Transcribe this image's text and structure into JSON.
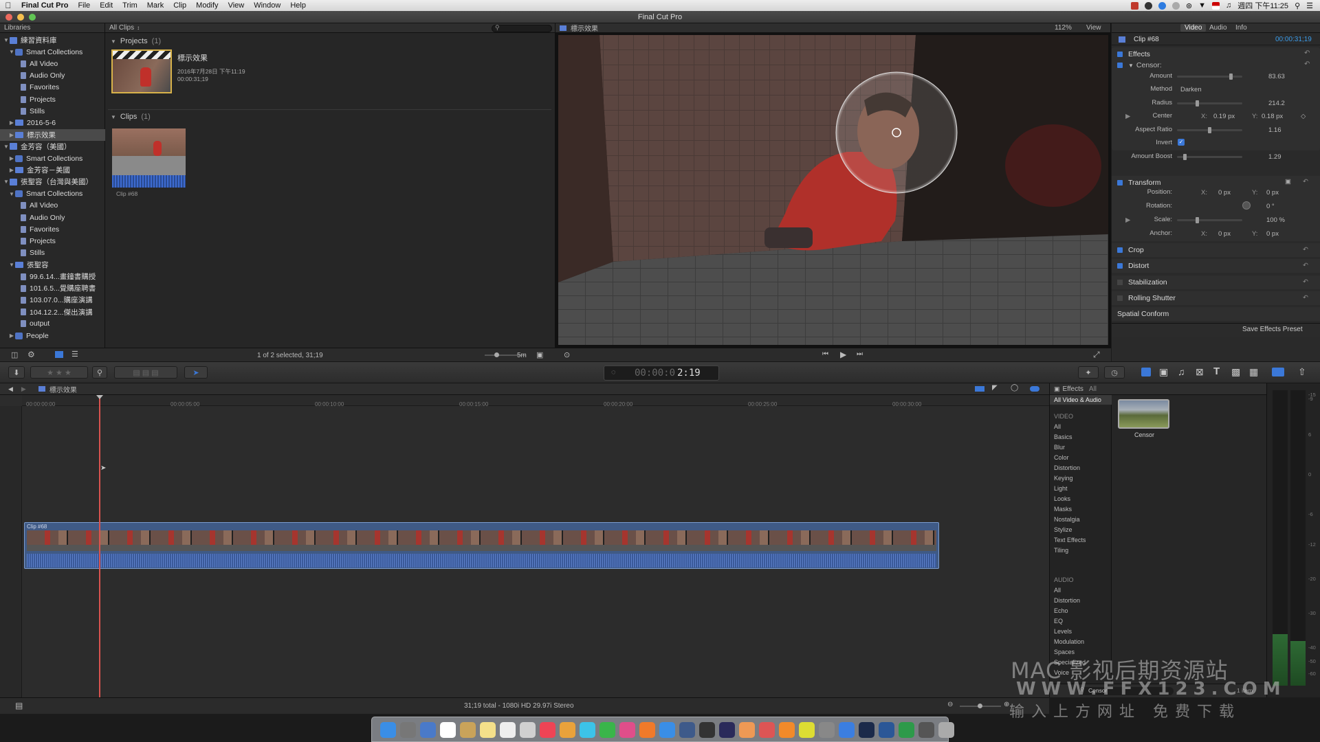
{
  "menubar": {
    "app": "Final Cut Pro",
    "items": [
      "File",
      "Edit",
      "Trim",
      "Mark",
      "Clip",
      "Modify",
      "View",
      "Window",
      "Help"
    ],
    "clock": "週四 下午11:25"
  },
  "window": {
    "title": "Final Cut Pro"
  },
  "libraries": {
    "header": "Libraries",
    "rows": [
      {
        "label": "練習資料庫",
        "level": 0,
        "icon": "library",
        "expanded": true
      },
      {
        "label": "Smart Collections",
        "level": 1,
        "icon": "folder",
        "expanded": true
      },
      {
        "label": "All Video",
        "level": 2,
        "icon": "smart-collection"
      },
      {
        "label": "Audio Only",
        "level": 2,
        "icon": "smart-collection"
      },
      {
        "label": "Favorites",
        "level": 2,
        "icon": "smart-collection"
      },
      {
        "label": "Projects",
        "level": 2,
        "icon": "smart-collection"
      },
      {
        "label": "Stills",
        "level": 2,
        "icon": "smart-collection"
      },
      {
        "label": "2016-5-6",
        "level": 1,
        "icon": "event",
        "collapsed": true
      },
      {
        "label": "標示效果",
        "level": 1,
        "icon": "event",
        "collapsed": true,
        "selected": true
      },
      {
        "label": "金芳容（美國）",
        "level": 0,
        "icon": "library",
        "expanded": true
      },
      {
        "label": "Smart Collections",
        "level": 1,
        "icon": "folder",
        "collapsed": true
      },
      {
        "label": "金芳容－美國",
        "level": 1,
        "icon": "event",
        "collapsed": true
      },
      {
        "label": "張聖容（台灣與美國）",
        "level": 0,
        "icon": "library",
        "expanded": true
      },
      {
        "label": "Smart Collections",
        "level": 1,
        "icon": "folder",
        "expanded": true
      },
      {
        "label": "All Video",
        "level": 2,
        "icon": "smart-collection"
      },
      {
        "label": "Audio Only",
        "level": 2,
        "icon": "smart-collection"
      },
      {
        "label": "Favorites",
        "level": 2,
        "icon": "smart-collection"
      },
      {
        "label": "Projects",
        "level": 2,
        "icon": "smart-collection"
      },
      {
        "label": "Stills",
        "level": 2,
        "icon": "smart-collection"
      },
      {
        "label": "張聖容",
        "level": 1,
        "icon": "event",
        "expanded": true
      },
      {
        "label": "99.6.14...畫鐘書購授",
        "level": 2,
        "icon": "project"
      },
      {
        "label": "101.6.5...覺購座聘書",
        "level": 2,
        "icon": "project"
      },
      {
        "label": "103.07.0...購座演講",
        "level": 2,
        "icon": "project"
      },
      {
        "label": "104.12.2...傑出演講",
        "level": 2,
        "icon": "project"
      },
      {
        "label": "output",
        "level": 2,
        "icon": "project"
      },
      {
        "label": "People",
        "level": 1,
        "icon": "folder",
        "collapsed": true
      }
    ]
  },
  "browser": {
    "filter": "All Clips",
    "projects_label": "Projects",
    "projects_count": "(1)",
    "project_name": "標示效果",
    "project_date": "2016年7月28日 下午11:19",
    "project_duration": "00:00:31;19",
    "clips_label": "Clips",
    "clips_count": "(1)",
    "clip_name": "Clip #68",
    "status": "1 of 2 selected, 31;19",
    "zoom": "5m"
  },
  "viewer": {
    "title": "標示效果",
    "zoom": "112%",
    "view": "View"
  },
  "inspector": {
    "tabs": [
      "Video",
      "Audio",
      "Info"
    ],
    "clip": "Clip #68",
    "timecode": "00:00:31;19",
    "effects": "Effects",
    "censor": "Censor:",
    "amount_label": "Amount",
    "amount": "83.63",
    "amount_level": 0.84,
    "method_label": "Method",
    "method": "Darken",
    "radius_label": "Radius",
    "radius": "214.2",
    "radius_level": 0.3,
    "center_label": "Center",
    "center_x": "0.19 px",
    "center_y": "0.18 px",
    "aspect_label": "Aspect Ratio",
    "aspect": "1.16",
    "aspect_level": 0.5,
    "invert_label": "Invert",
    "boost_label": "Amount Boost",
    "boost": "1.29",
    "boost_level": 0.1,
    "transform": "Transform",
    "position_label": "Position:",
    "pos_x": "0 px",
    "pos_y": "0 px",
    "rotation_label": "Rotation:",
    "rotation": "0 °",
    "scale_label": "Scale:",
    "scale": "100 %",
    "scale_level": 0.3,
    "anchor_label": "Anchor:",
    "anchor_x": "0 px",
    "anchor_y": "0 px",
    "crop": "Crop",
    "distort": "Distort",
    "stabilization": "Stabilization",
    "rolling": "Rolling Shutter",
    "spatial": "Spatial Conform",
    "save_preset": "Save Effects Preset"
  },
  "toolbar": {
    "timecode": "2:19"
  },
  "timeline": {
    "project": "標示效果",
    "ticks": [
      "00:00:00:00",
      "00:00:05:00",
      "00:00:10:00",
      "00:00:15:00",
      "00:00:20:00",
      "00:00:25:00",
      "00:00:30:00"
    ],
    "clip_label": "Clip #68",
    "status": "31;19 total - 1080i HD 29.97i Stereo"
  },
  "effects_browser": {
    "title": "Effects",
    "filter": "All",
    "all_label": "All Video & Audio",
    "video_header": "VIDEO",
    "video": [
      "All",
      "Basics",
      "Blur",
      "Color",
      "Distortion",
      "Keying",
      "Light",
      "Looks",
      "Masks",
      "Nostalgia",
      "Stylize",
      "Text Effects",
      "Tiling"
    ],
    "audio_header": "AUDIO",
    "audio": [
      "All",
      "Distortion",
      "Echo",
      "EQ",
      "Levels",
      "Modulation",
      "Spaces",
      "Specialized",
      "Voice"
    ],
    "effect_name": "Censor",
    "search_value": "Censor",
    "count": "1 item"
  },
  "meters": {
    "scale": [
      "-15",
      "-9",
      "6",
      "0",
      "-6",
      "-12",
      "-20",
      "-30",
      "-40",
      "-50",
      "-60"
    ]
  },
  "watermark": {
    "line1": "MAC 影视后期资源站",
    "line2": "WWW.FFX123.COM",
    "line3": "输入上方网址 免费下载"
  },
  "colors": {
    "accent": "#3b78d8",
    "playhead": "#d9534f",
    "clip": "#3f5a86"
  }
}
